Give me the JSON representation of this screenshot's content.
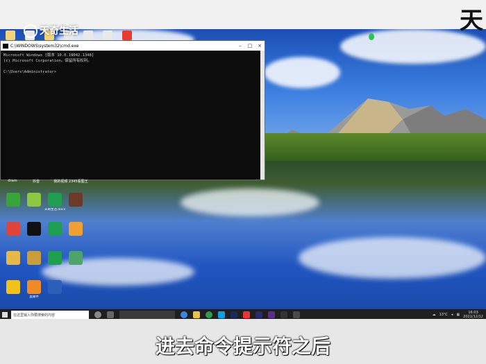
{
  "watermark": {
    "logo_text": "天奇生活",
    "corner_char": "天"
  },
  "cmd": {
    "title": "C:\\WINDOWS\\system32\\cmd.exe",
    "lines": [
      "Microsoft Windows [版本 10.0.19042.1348]",
      "(c) Microsoft Corporation。保留所有权利。",
      "",
      "C:\\Users\\Administrator>"
    ]
  },
  "desktop": {
    "top_labels": [
      "dram",
      "抖音",
      "我的视频 2345看图王"
    ],
    "icons": [
      {
        "label": "",
        "color": "#3aa33a"
      },
      {
        "label": "",
        "color": "#8dc63f"
      },
      {
        "label": "天奇生活.docx",
        "color": "#1e9e4e"
      },
      {
        "label": "",
        "color": "#6b3a2a"
      },
      {
        "label": "",
        "color": "#e0433a"
      },
      {
        "label": "",
        "color": "#111111"
      },
      {
        "label": "",
        "color": "#1e9e4e"
      },
      {
        "label": "",
        "color": "#f0a030"
      },
      {
        "label": "",
        "color": "#e6b84a"
      },
      {
        "label": "",
        "color": "#c99e3a"
      },
      {
        "label": "",
        "color": "#1e9e4e"
      },
      {
        "label": "",
        "color": "#4da36a"
      },
      {
        "label": "",
        "color": "#f2c21b"
      },
      {
        "label": "直播伴",
        "color": "#f08a24"
      },
      {
        "label": "",
        "color": "#2b5fb8"
      }
    ]
  },
  "taskbar": {
    "search_placeholder": "在这里输入你要搜索的内容",
    "tray_text": "13°C",
    "clock_time": "16:03",
    "clock_date": "2021/12/12"
  },
  "subtitle": "进去命令提示符之后",
  "colors": {
    "taskbar": "#1f1f1f",
    "cmd_bg": "#0c0c0c"
  }
}
